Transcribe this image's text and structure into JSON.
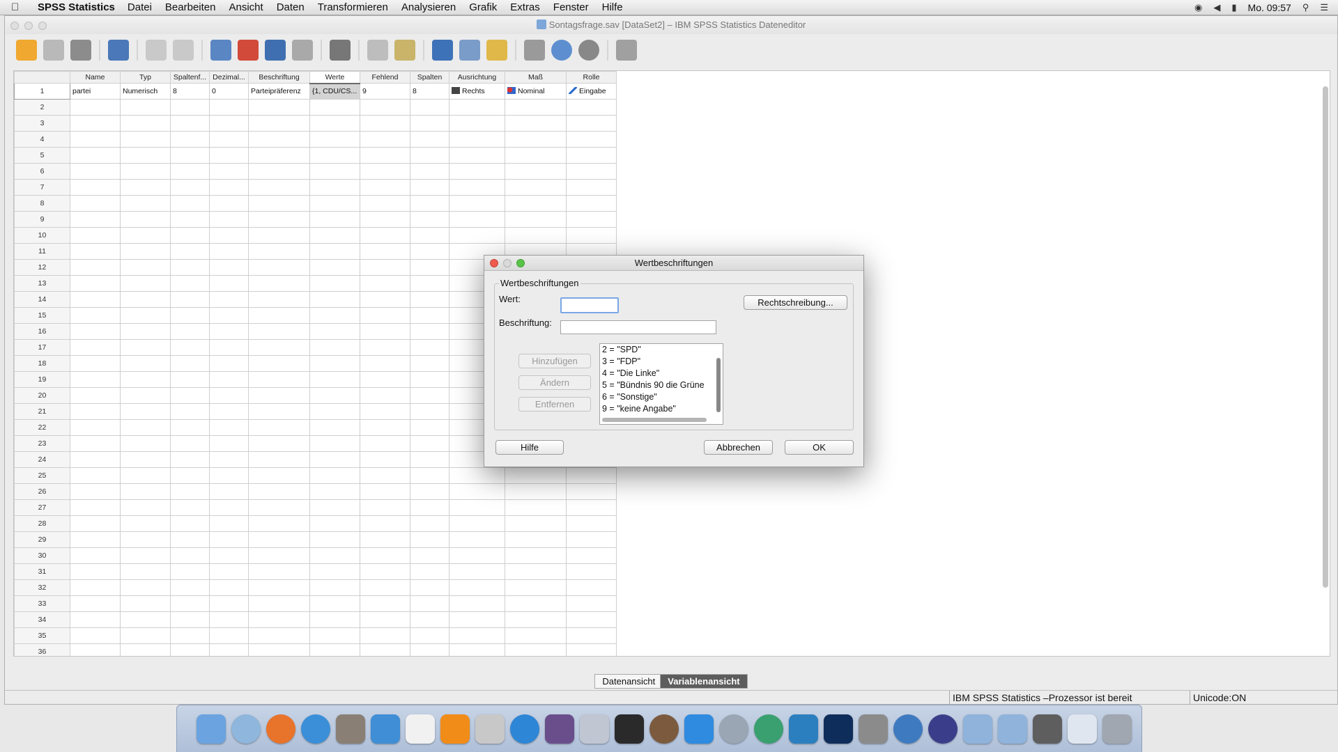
{
  "menubar": {
    "app_name": "SPSS Statistics",
    "items": [
      "Datei",
      "Bearbeiten",
      "Ansicht",
      "Daten",
      "Transformieren",
      "Analysieren",
      "Grafik",
      "Extras",
      "Fenster",
      "Hilfe"
    ],
    "clock": "Mo. 09:57"
  },
  "window": {
    "title": "Sontagsfrage.sav [DataSet2] – IBM SPSS Statistics Dateneditor"
  },
  "grid": {
    "columns": [
      "Name",
      "Typ",
      "Spaltenf...",
      "Dezimal...",
      "Beschriftung",
      "Werte",
      "Fehlend",
      "Spalten",
      "Ausrichtung",
      "Maß",
      "Rolle"
    ],
    "row1": {
      "num": "1",
      "name": "partei",
      "typ": "Numerisch",
      "spaltenformat": "8",
      "dezimal": "0",
      "beschriftung": "Parteipräferenz",
      "werte": "{1, CDU/CS...",
      "fehlend": "9",
      "spalten": "8",
      "ausrichtung": "Rechts",
      "mass": "Nominal",
      "rolle": "Eingabe"
    },
    "row_numbers": [
      "2",
      "3",
      "4",
      "5",
      "6",
      "7",
      "8",
      "9",
      "10",
      "11",
      "12",
      "13",
      "14",
      "15",
      "16",
      "17",
      "18",
      "19",
      "20",
      "21",
      "22",
      "23",
      "24",
      "25",
      "26",
      "27",
      "28",
      "29",
      "30",
      "31",
      "32",
      "33",
      "34",
      "35",
      "36"
    ]
  },
  "tabs": {
    "data_view": "Datenansicht",
    "variable_view": "Variablenansicht"
  },
  "status": {
    "processor": "IBM SPSS Statistics –Prozessor ist bereit",
    "unicode": "Unicode:ON"
  },
  "dialog": {
    "title": "Wertbeschriftungen",
    "group_label": "Wertbeschriftungen",
    "value_label": "Wert:",
    "value_input": "",
    "label_label": "Beschriftung:",
    "label_input": "",
    "spelling_button": "Rechtschreibung...",
    "add_button": "Hinzufügen",
    "change_button": "Ändern",
    "remove_button": "Entfernen",
    "value_list": [
      "2 = \"SPD\"",
      "3 = \"FDP\"",
      "4 = \"Die Linke\"",
      "5 = \"Bündnis 90 die Grüne",
      "6 = \"Sonstige\"",
      "9 = \"keine Angabe\""
    ],
    "help_button": "Hilfe",
    "cancel_button": "Abbrechen",
    "ok_button": "OK"
  },
  "colors": {
    "accent": "#3b7dd8",
    "dock": "#b7c6de"
  }
}
